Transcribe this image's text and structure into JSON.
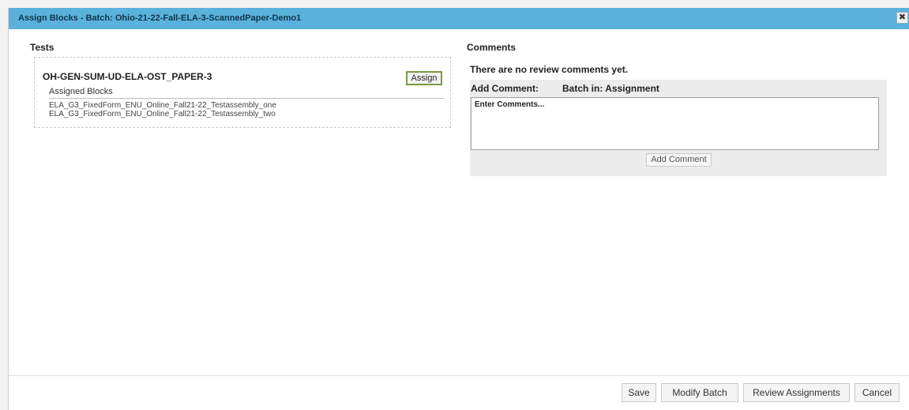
{
  "dialog": {
    "title": "Assign Blocks - Batch: Ohio-21-22-Fall-ELA-3-ScannedPaper-Demo1",
    "close_glyph": "✖"
  },
  "tests": {
    "heading": "Tests",
    "test_name": "OH-GEN-SUM-UD-ELA-OST_PAPER-3",
    "assign_label": "Assign",
    "assigned_blocks_label": "Assigned Blocks",
    "blocks": [
      "ELA_G3_FixedForm_ENU_Online_Fall21-22_Testassembly_one",
      "ELA_G3_FixedForm_ENU_Online_Fall21-22_Testassembly_two"
    ]
  },
  "comments": {
    "heading": "Comments",
    "empty_message": "There are no review comments yet.",
    "add_comment_label": "Add Comment:",
    "batch_status": "Batch in: Assignment",
    "placeholder": "Enter Comments...",
    "add_button": "Add Comment"
  },
  "footer": {
    "save": "Save",
    "modify_batch": "Modify Batch",
    "review_assignments": "Review Assignments",
    "cancel": "Cancel"
  },
  "colors": {
    "titlebar": "#5ab1dc",
    "assign_border": "#7c9a44"
  }
}
